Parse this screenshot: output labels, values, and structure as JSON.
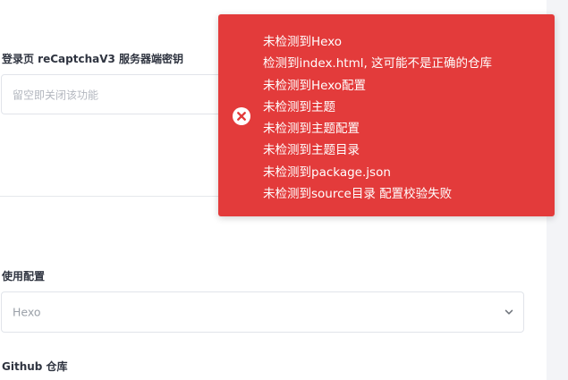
{
  "form": {
    "recaptcha_secret": {
      "label": "登录页 reCaptchaV3 服务器端密钥",
      "placeholder": "留空即关闭该功能"
    },
    "config_use": {
      "label": "使用配置",
      "selected_value": "Hexo"
    },
    "github_repo": {
      "label": "Github 仓库"
    }
  },
  "toast": {
    "type": "error",
    "icon": "close-circle-icon",
    "lines": [
      "未检测到Hexo",
      "检测到index.html, 这可能不是正确的仓库",
      "未检测到Hexo配置",
      "未检测到主题",
      "未检测到主题配置",
      "未检测到主题目录",
      "未检测到package.json",
      "未检测到source目录 配置校验失败"
    ]
  },
  "colors": {
    "toast_background": "#e33b3b",
    "label_text": "#2f3440",
    "placeholder_text": "#b3b7bf",
    "input_border": "#e1e4ea",
    "side_gutter": "#f3f4f7"
  }
}
